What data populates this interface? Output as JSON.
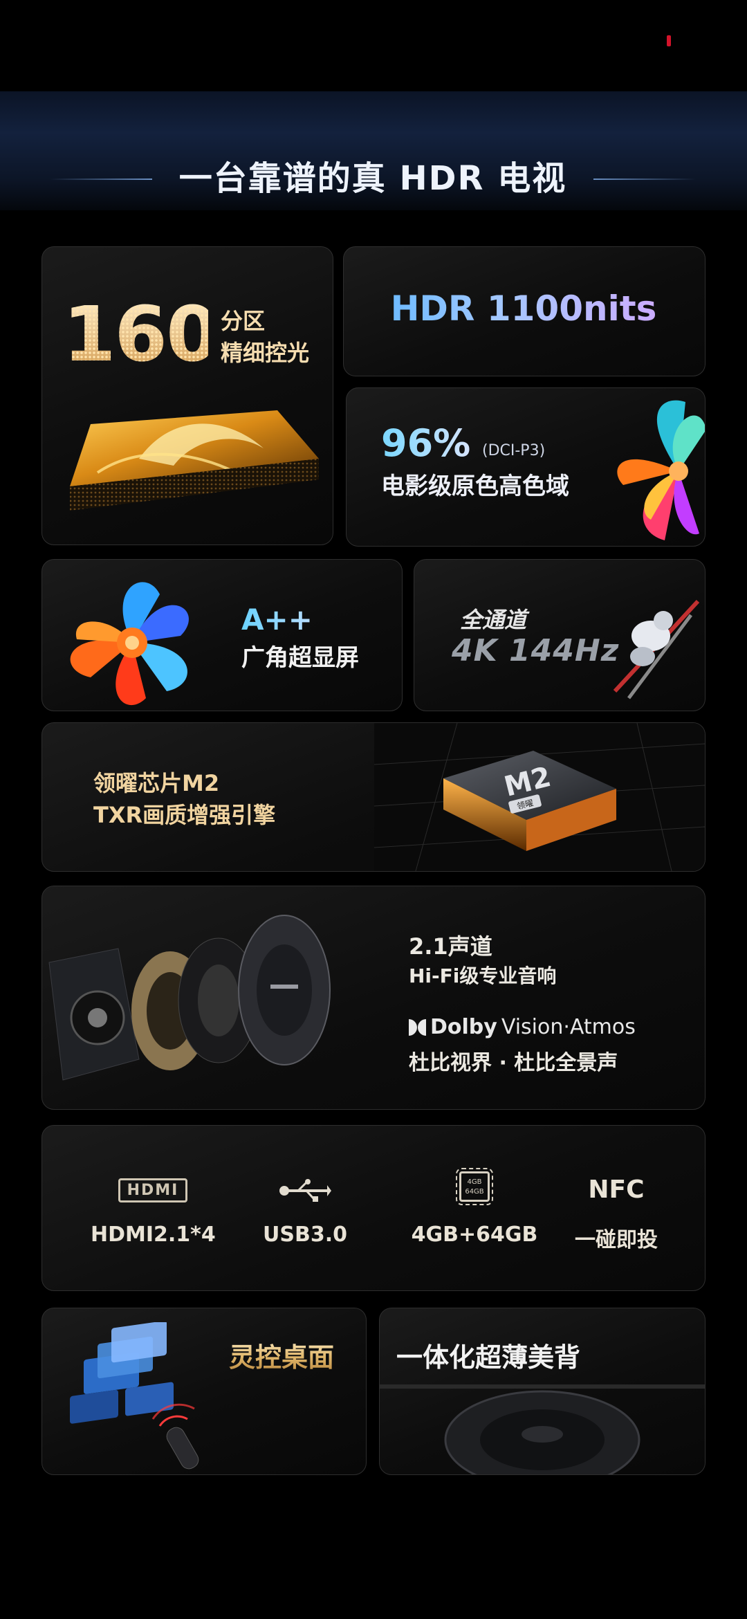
{
  "header": {
    "title": "一台靠谱的真 HDR 电视"
  },
  "local_dimming": {
    "number": "160",
    "line1": "分区",
    "line2": "精细控光"
  },
  "hdr": {
    "title": "HDR 1100nits"
  },
  "color_gamut": {
    "percent": "96%",
    "standard": "(DCI-P3)",
    "subtitle": "电影级原色高色域"
  },
  "screen": {
    "title": "A++",
    "subtitle": "广角超显屏"
  },
  "refresh": {
    "line1": "全通道",
    "line2": "4K 144Hz"
  },
  "chip": {
    "line1": "领曜芯片M2",
    "line2": "TXR画质增强引擎",
    "chip_label": "M2",
    "chip_badge": "领曜"
  },
  "sound": {
    "channel": "2.1声道",
    "hifi": "Hi-Fi级专业音响",
    "dolby_brand": "Dolby",
    "dolby_suffix": "Vision·Atmos",
    "dolby_cn": "杜比视界 · 杜比全景声"
  },
  "ports": [
    {
      "label": "HDMI2.1*4",
      "icon": "hdmi-icon",
      "icon_text": "HDMI"
    },
    {
      "label": "USB3.0",
      "icon": "usb-icon",
      "icon_text": ""
    },
    {
      "label": "4GB+64GB",
      "icon": "memory-chip-icon",
      "icon_text": "4GB 64GB"
    },
    {
      "label": "一碰即投",
      "icon": "nfc-icon",
      "icon_text": "NFC"
    }
  ],
  "bottom": {
    "left_title": "灵控桌面",
    "right_title": "一体化超薄美背"
  },
  "colors": {
    "accent_gold": "#f0d59a",
    "accent_blue": "#58b6ff",
    "background": "#000000",
    "status_red": "#d3132a"
  }
}
